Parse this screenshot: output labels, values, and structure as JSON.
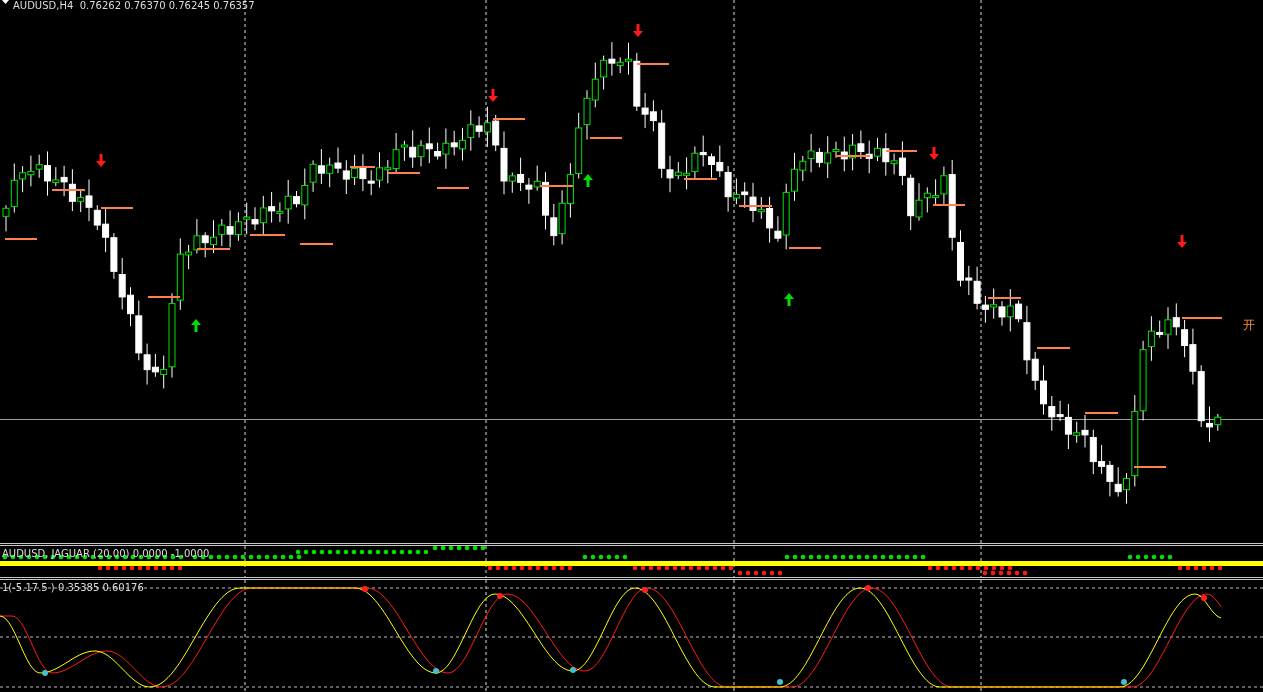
{
  "chart": {
    "header": "AUDUSD,H4  0.76262 0.76370 0.76245 0.76357",
    "marker": "开"
  },
  "indicator": {
    "label": "AUDUSD, JAGUAR (20.00) 0.0000 -1.0000"
  },
  "oscillator": {
    "label": "1(-5.17.5 ) 0.35385 0.60176"
  }
}
